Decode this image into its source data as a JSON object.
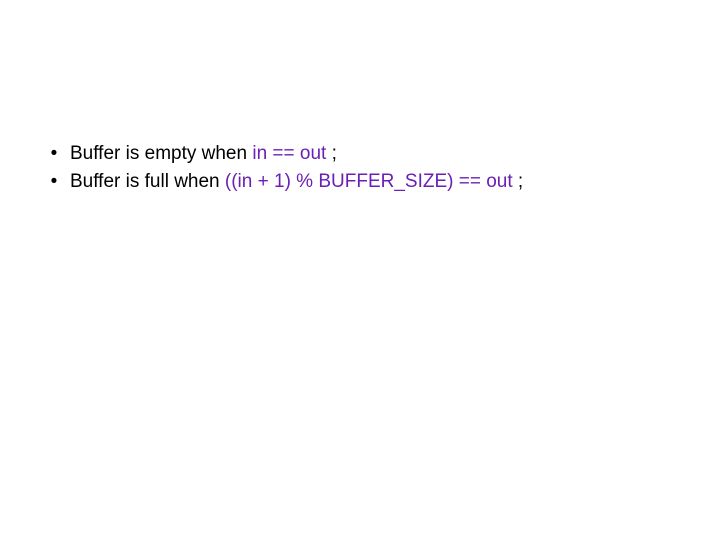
{
  "bullets": [
    {
      "parts": [
        {
          "text": "Buffer is empty when ",
          "cls": "text-black"
        },
        {
          "text": "in == out ",
          "cls": "text-purple"
        },
        {
          "text": ";",
          "cls": "text-black"
        }
      ]
    },
    {
      "parts": [
        {
          "text": "Buffer is full when ",
          "cls": "text-black"
        },
        {
          "text": "((in + 1) % BUFFER_SIZE) == out ",
          "cls": "text-purple"
        },
        {
          "text": ";",
          "cls": "text-black"
        }
      ]
    }
  ],
  "bullet_char": "•"
}
